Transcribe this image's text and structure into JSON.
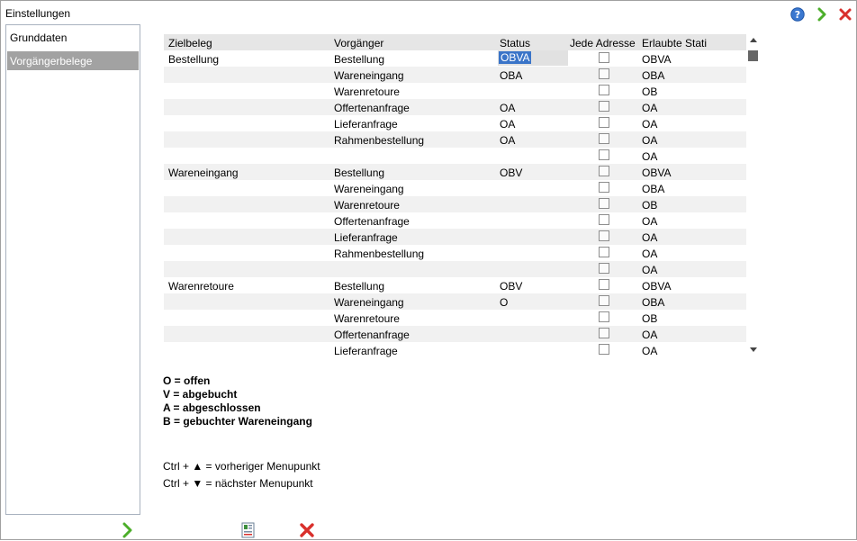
{
  "window": {
    "title": "Einstellungen"
  },
  "titlebar_icons": [
    "help-icon",
    "next-icon",
    "close-icon"
  ],
  "sidebar": {
    "items": [
      {
        "label": "Grunddaten",
        "selected": false
      },
      {
        "label": "Vorgängerbelege",
        "selected": true
      }
    ]
  },
  "grid": {
    "columns": [
      "Zielbeleg",
      "Vorgänger",
      "Status",
      "Jede Adresse",
      "Erlaubte Stati"
    ],
    "rows": [
      {
        "ziel": "Bestellung",
        "vorg": "Bestellung",
        "status": "OBVA",
        "jede": false,
        "stati": "OBVA",
        "selected_status": true
      },
      {
        "ziel": "",
        "vorg": "Wareneingang",
        "status": "OBA",
        "jede": false,
        "stati": "OBA"
      },
      {
        "ziel": "",
        "vorg": "Warenretoure",
        "status": "",
        "jede": false,
        "stati": "OB"
      },
      {
        "ziel": "",
        "vorg": "Offertenanfrage",
        "status": "OA",
        "jede": false,
        "stati": "OA"
      },
      {
        "ziel": "",
        "vorg": "Lieferanfrage",
        "status": "OA",
        "jede": false,
        "stati": "OA"
      },
      {
        "ziel": "",
        "vorg": "Rahmenbestellung",
        "status": "OA",
        "jede": false,
        "stati": "OA"
      },
      {
        "ziel": "",
        "vorg": "",
        "status": "",
        "jede": false,
        "stati": "OA"
      },
      {
        "ziel": "Wareneingang",
        "vorg": "Bestellung",
        "status": "OBV",
        "jede": false,
        "stati": "OBVA"
      },
      {
        "ziel": "",
        "vorg": "Wareneingang",
        "status": "",
        "jede": false,
        "stati": "OBA"
      },
      {
        "ziel": "",
        "vorg": "Warenretoure",
        "status": "",
        "jede": false,
        "stati": "OB"
      },
      {
        "ziel": "",
        "vorg": "Offertenanfrage",
        "status": "",
        "jede": false,
        "stati": "OA"
      },
      {
        "ziel": "",
        "vorg": "Lieferanfrage",
        "status": "",
        "jede": false,
        "stati": "OA"
      },
      {
        "ziel": "",
        "vorg": "Rahmenbestellung",
        "status": "",
        "jede": false,
        "stati": "OA"
      },
      {
        "ziel": "",
        "vorg": "",
        "status": "",
        "jede": false,
        "stati": "OA"
      },
      {
        "ziel": "Warenretoure",
        "vorg": "Bestellung",
        "status": "OBV",
        "jede": false,
        "stati": "OBVA"
      },
      {
        "ziel": "",
        "vorg": "Wareneingang",
        "status": "O",
        "jede": false,
        "stati": "OBA"
      },
      {
        "ziel": "",
        "vorg": "Warenretoure",
        "status": "",
        "jede": false,
        "stati": "OB"
      },
      {
        "ziel": "",
        "vorg": "Offertenanfrage",
        "status": "",
        "jede": false,
        "stati": "OA"
      },
      {
        "ziel": "",
        "vorg": "Lieferanfrage",
        "status": "",
        "jede": false,
        "stati": "OA"
      }
    ]
  },
  "legend": [
    "O = offen",
    "V = abgebucht",
    "A = abgeschlossen",
    "B = gebuchter Wareneingang"
  ],
  "hints": {
    "prev": "Ctrl + ▲ = vorheriger Menupunkt",
    "next": "Ctrl + ▼ = nächster Menupunkt"
  },
  "bottom_icons": [
    "ok-arrow-icon",
    "document-icon",
    "cancel-icon"
  ],
  "colors": {
    "selection_blue": "#3a74c8",
    "sidebar_selected": "#a2a2a2",
    "header_bg": "#e6e6e6",
    "alt_row": "#f1f1f1",
    "close_red": "#d9302c",
    "next_green": "#4cae2a"
  }
}
